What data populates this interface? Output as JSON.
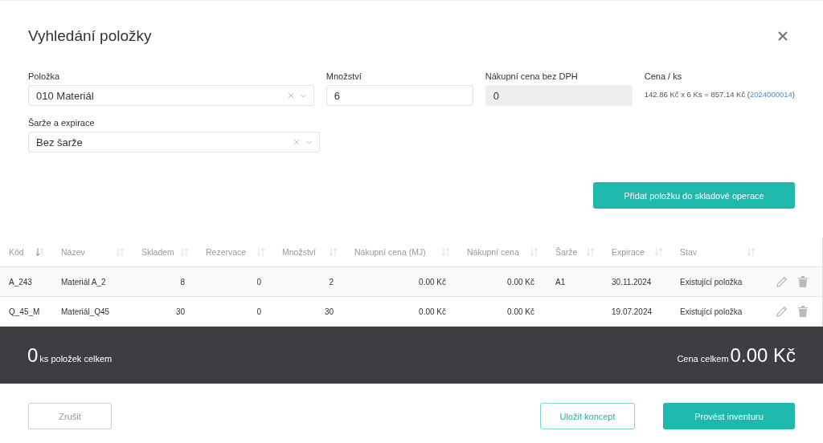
{
  "dialog": {
    "title": "Vyhledání položky"
  },
  "form": {
    "item": {
      "label": "Položka",
      "value": "010 Materiál"
    },
    "quantity": {
      "label": "Množství",
      "value": "6"
    },
    "price": {
      "label": "Nákupní cena bez DPH",
      "value": "0",
      "disabled": true
    },
    "unit_price": {
      "label": "Cena / ks",
      "text": "142.86 Kč x 6 Ks = 857.14 Kč (",
      "link": "2024000014",
      "suffix": ")"
    },
    "batch": {
      "label": "Šarže a expirace",
      "value": "Bez šarže"
    },
    "add_button": "Přidat položku do skladové operace"
  },
  "table": {
    "columns": [
      {
        "label": "Kód",
        "sorted": true
      },
      {
        "label": "Název",
        "sorted": false
      },
      {
        "label": "Skladem",
        "sorted": false
      },
      {
        "label": "Rezervace",
        "sorted": false
      },
      {
        "label": "Množství",
        "sorted": false
      },
      {
        "label": "Nákupní cena (MJ)",
        "sorted": false
      },
      {
        "label": "Nákupní cena",
        "sorted": false
      },
      {
        "label": "Šarže",
        "sorted": false
      },
      {
        "label": "Expirace",
        "sorted": false
      },
      {
        "label": "Stav",
        "sorted": false
      }
    ],
    "rows": [
      {
        "cells": [
          "A_243",
          "Materiál A_2",
          "8",
          "0",
          "2",
          "0.00 Kč",
          "0.00 Kč",
          "A1",
          "30.11.2024",
          "Existující položka"
        ]
      },
      {
        "cells": [
          "Q_45_M",
          "Materiál_Q45",
          "30",
          "0",
          "30",
          "0.00 Kč",
          "0.00 Kč",
          "",
          "19.07.2024",
          "Existující položka"
        ]
      }
    ]
  },
  "summary": {
    "count": "0",
    "count_label": "ks položek celkem",
    "total_label": "Cena celkem",
    "total": "0.00 Kč"
  },
  "buttons": [
    {
      "label": "Zrušit",
      "kind": "cancel"
    },
    {
      "label": "Uložit koncept",
      "kind": "outline"
    },
    {
      "label": "Provést inventuru",
      "kind": "primary"
    }
  ]
}
